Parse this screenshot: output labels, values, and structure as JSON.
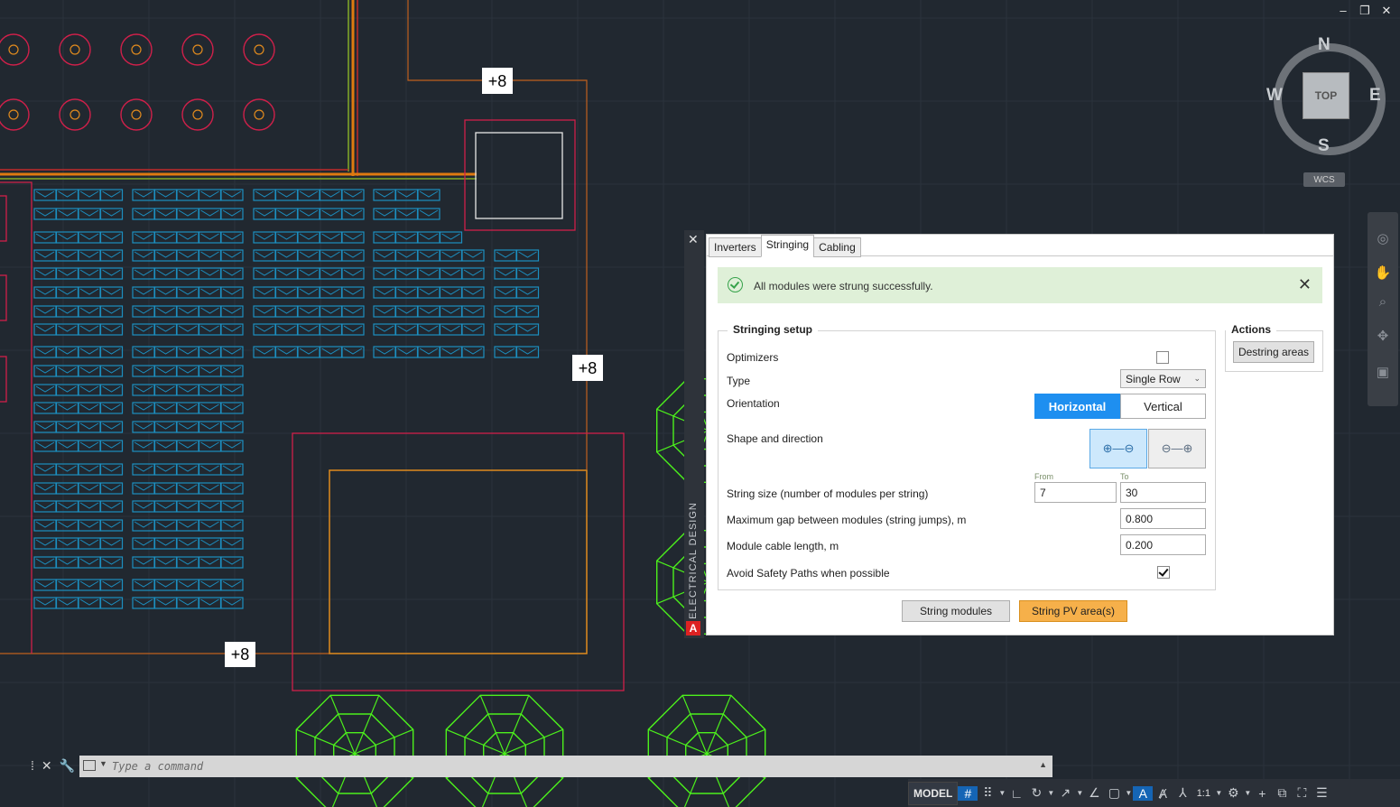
{
  "window_controls": {
    "minimize": "–",
    "restore": "❐",
    "close": "✕"
  },
  "viewcube": {
    "top": "TOP",
    "north": "N",
    "south": "S",
    "east": "E",
    "west": "W",
    "wcs": "WCS"
  },
  "drawing": {
    "label_1": "+8",
    "label_2": "+8",
    "label_3": "+8"
  },
  "palette": {
    "side_title": "ELECTRICAL DESIGN",
    "logo": "A",
    "tabs": [
      {
        "label": "Inverters"
      },
      {
        "label": "Stringing"
      },
      {
        "label": "Cabling"
      }
    ],
    "alert_message": "All modules were strung successfully.",
    "setup": {
      "title": "Stringing setup",
      "optimizers_label": "Optimizers",
      "optimizers_checked": false,
      "type_label": "Type",
      "type_value": "Single Row",
      "orientation_label": "Orientation",
      "orientation_options": [
        "Horizontal",
        "Vertical"
      ],
      "orientation_selected": "Horizontal",
      "shape_label": "Shape and direction",
      "shape_option_1": "⊕—⊖",
      "shape_option_2": "⊖—⊕",
      "from_label": "From",
      "to_label": "To",
      "string_size_label": "String size (number of modules per string)",
      "string_size_from": "7",
      "string_size_to": "30",
      "max_gap_label": "Maximum gap between modules (string jumps), m",
      "max_gap_value": "0.800",
      "cable_length_label": "Module cable length, m",
      "cable_length_value": "0.200",
      "avoid_label": "Avoid Safety Paths when possible",
      "avoid_checked": true
    },
    "actions": {
      "title": "Actions",
      "button": "Destring areas"
    },
    "buttons": {
      "string_modules": "String modules",
      "string_pv": "String PV area(s)"
    }
  },
  "command_line": {
    "placeholder": "Type a command"
  },
  "status_bar": {
    "model": "MODEL",
    "scale": "1:1"
  },
  "colors": {
    "background": "#212830",
    "module_blue": "#1c8fc0",
    "boundary_red": "#d0204a",
    "orange_line": "#e08a1e",
    "tree_green": "#4cf01c",
    "accent_blue": "#1e8ff0",
    "success_bg": "#dff0d8",
    "action_orange": "#f6b04a"
  }
}
